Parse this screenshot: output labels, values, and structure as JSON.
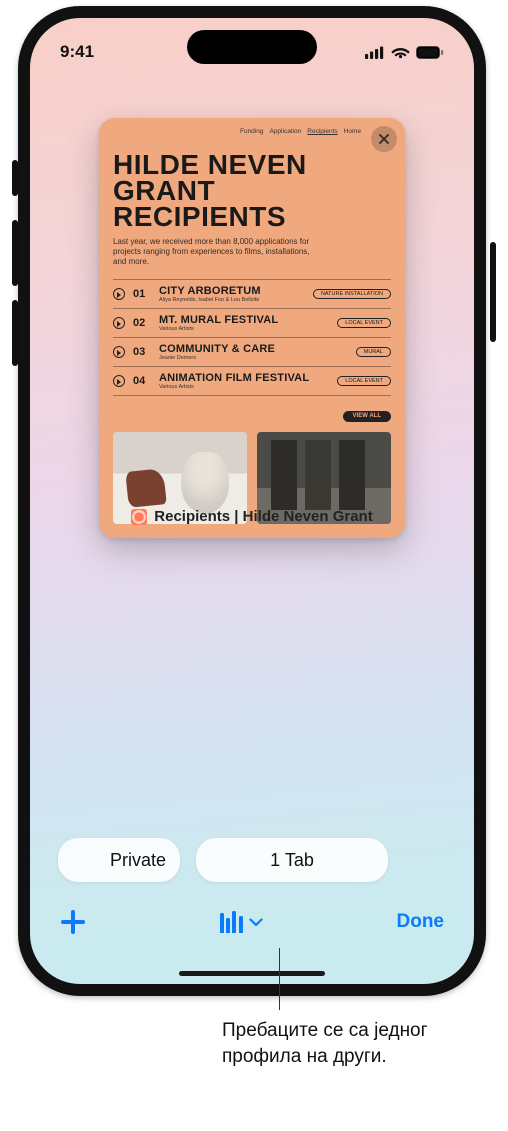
{
  "status": {
    "time": "9:41"
  },
  "card": {
    "nav": [
      "Funding",
      "Application",
      "Recipients",
      "Home"
    ],
    "nav_current_index": 2,
    "title_line1": "HILDE NEVEN",
    "title_line2": "GRANT RECIPIENTS",
    "subtitle": "Last year, we received more than 8,000 applications for projects ranging from experiences to films, installations, and more.",
    "rows": [
      {
        "num": "01",
        "name": "CITY ARBORETUM",
        "by": "Aliya Reynolds, Isabel Foo & Lou Bellsite",
        "tag": "NATURE INSTALLATION"
      },
      {
        "num": "02",
        "name": "MT. MURAL FESTIVAL",
        "by": "Various Artists",
        "tag": "LOCAL EVENT"
      },
      {
        "num": "03",
        "name": "COMMUNITY & CARE",
        "by": "Jeanie Demers",
        "tag": "MURAL"
      },
      {
        "num": "04",
        "name": "ANIMATION FILM FESTIVAL",
        "by": "Various Artists",
        "tag": "LOCAL EVENT"
      }
    ],
    "view_all": "VIEW ALL"
  },
  "tab_title": "Recipients | Hilde Neven Grant",
  "groups": {
    "private": "Private",
    "count": "1 Tab"
  },
  "toolbar": {
    "done": "Done"
  },
  "callout": "Пребаците се са једног профила на други."
}
